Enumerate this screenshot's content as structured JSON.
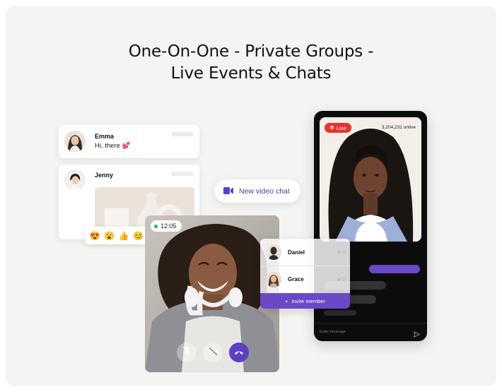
{
  "headline": {
    "line1": "One-On-One - Private Groups -",
    "line2": "Live Events & Chats"
  },
  "chat_cards": [
    {
      "name": "Emma",
      "message": "Hi, there",
      "emoji": "💕"
    },
    {
      "name": "Jenny"
    }
  ],
  "reactions": [
    "😍",
    "😮",
    "👍",
    "😊"
  ],
  "video_chat_button": {
    "label": "New video chat",
    "icon": "video-camera-icon"
  },
  "call": {
    "time": "12:05",
    "controls": [
      "mic-muted-icon",
      "camera-off-icon",
      "end-call-icon"
    ]
  },
  "members_panel": {
    "members": [
      {
        "name": "Daniel"
      },
      {
        "name": "Grace"
      }
    ],
    "invite_label": "Invite member",
    "invite_icon": "plus-icon"
  },
  "phone": {
    "live_label": "Live",
    "online_count": "3,204,231 online",
    "input_placeholder": "Enter message",
    "send_icon": "send-icon"
  },
  "colors": {
    "accent": "#5c3fc4",
    "invite": "#6a48c7",
    "live": "#e8322f",
    "online_dot": "#1dbd5b",
    "background": "#f4f4f3"
  }
}
